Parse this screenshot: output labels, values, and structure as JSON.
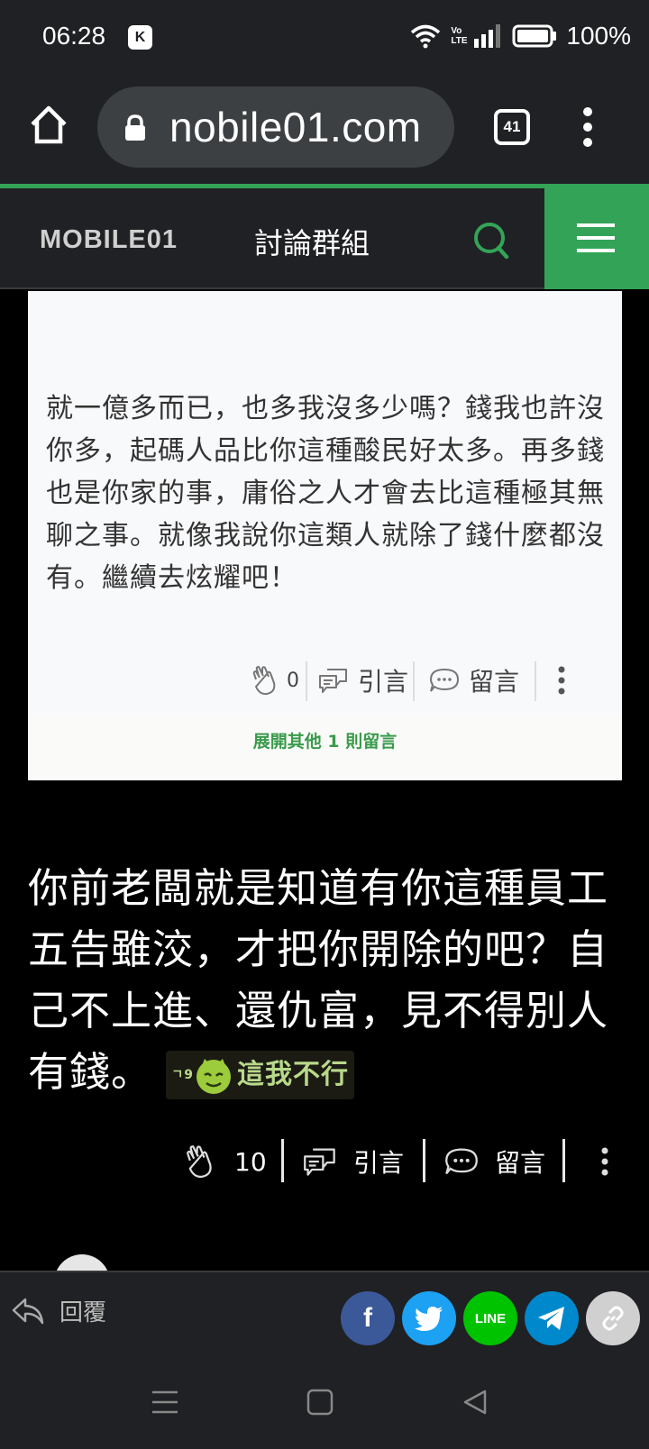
{
  "status_bar": {
    "time": "06:28",
    "k_badge": "K",
    "network_label": "Vo LTE",
    "battery": "100%"
  },
  "browser": {
    "url": "nobile01.com",
    "tab_count": "41"
  },
  "site_header": {
    "logo": "MOBILE01",
    "section_title": "討論群組",
    "accent_color": "#33a457"
  },
  "comment_card": {
    "text": "就一億多而已，也多我沒多少嗎？錢我也許沒你多，起碼人品比你這種酸民好太多。再多錢也是你家的事，庸俗之人才會去比這種極其無聊之事。就像我說你這類人就除了錢什麼都沒有。繼續去炫耀吧！",
    "like_count": "0",
    "quote_label": "引言",
    "comment_label": "留言",
    "expand_label": "展開其他 1 則留言"
  },
  "post": {
    "text": "你前老闆就是知道有你這種員工五告雖洨，才把你開除的吧？自己不上進、還仇富，見不得別人有錢。",
    "sticker_text": "這我不行",
    "sticker_small": "ㄱ9",
    "like_count": "10",
    "quote_label": "引言",
    "comment_label": "留言"
  },
  "bottom_bar": {
    "reply_label": "回覆",
    "share_facebook": "f",
    "share_line": "LINE",
    "colors": {
      "facebook": "#3b5998",
      "twitter": "#1da1f2",
      "line": "#00c300",
      "telegram": "#0088cc",
      "link": "#d0d0d0"
    }
  }
}
